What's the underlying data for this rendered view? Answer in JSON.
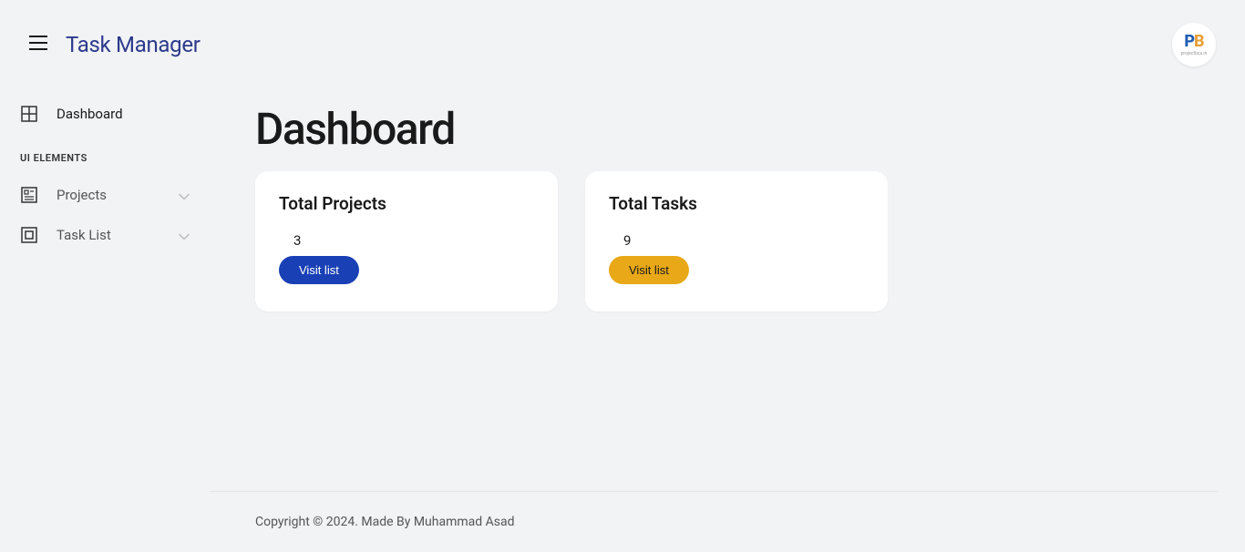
{
  "header": {
    "title": "Task Manager",
    "avatar": {
      "text_p": "P",
      "text_b": "B",
      "sub": "projectbca.in"
    }
  },
  "sidebar": {
    "dashboard": "Dashboard",
    "section_label": "UI ELEMENTS",
    "projects": "Projects",
    "task_list": "Task List"
  },
  "main": {
    "page_title": "Dashboard",
    "cards": {
      "projects": {
        "title": "Total Projects",
        "value": "3",
        "button": "Visit list"
      },
      "tasks": {
        "title": "Total Tasks",
        "value": "9",
        "button": "Visit list"
      }
    }
  },
  "footer": {
    "text": "Copyright © 2024. Made By Muhammad Asad"
  }
}
